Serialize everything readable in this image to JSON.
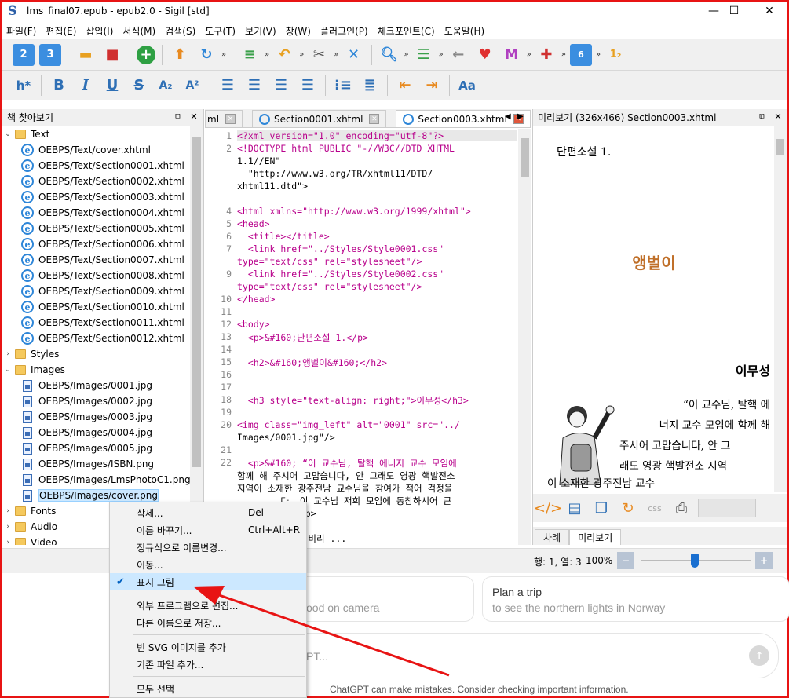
{
  "window": {
    "title": "lms_final07.epub - epub2.0 - Sigil [std]",
    "logo": "S",
    "min": "—",
    "max": "☐",
    "close": "✕"
  },
  "menu": [
    "파일(F)",
    "편집(E)",
    "삽입(I)",
    "서식(M)",
    "검색(S)",
    "도구(T)",
    "보기(V)",
    "창(W)",
    "플러그인(P)",
    "체크포인트(C)",
    "도움말(H)"
  ],
  "toolbar2": {
    "heading": "h*",
    "bold": "B",
    "italic": "I",
    "underline": "U",
    "strike": "S",
    "sub": "A₂",
    "sup": "A²",
    "case": "Aa"
  },
  "book_browser": {
    "title": "책 찾아보기",
    "folders": {
      "text": "Text",
      "styles": "Styles",
      "images": "Images",
      "fonts": "Fonts",
      "audio": "Audio",
      "video": "Video"
    },
    "text_files": [
      "OEBPS/Text/cover.xhtml",
      "OEBPS/Text/Section0001.xhtml",
      "OEBPS/Text/Section0002.xhtml",
      "OEBPS/Text/Section0003.xhtml",
      "OEBPS/Text/Section0004.xhtml",
      "OEBPS/Text/Section0005.xhtml",
      "OEBPS/Text/Section0006.xhtml",
      "OEBPS/Text/Section0007.xhtml",
      "OEBPS/Text/Section0008.xhtml",
      "OEBPS/Text/Section0009.xhtml",
      "OEBPS/Text/Section0010.xhtml",
      "OEBPS/Text/Section0011.xhtml",
      "OEBPS/Text/Section0012.xhtml"
    ],
    "image_files": [
      "OEBPS/Images/0001.jpg",
      "OEBPS/Images/0002.jpg",
      "OEBPS/Images/0003.jpg",
      "OEBPS/Images/0004.jpg",
      "OEBPS/Images/0005.jpg",
      "OEBPS/Images/ISBN.png",
      "OEBPS/Images/LmsPhotoC1.png",
      "OEBPS/Images/cover.png"
    ]
  },
  "editor": {
    "tabs": [
      "ml",
      "Section0001.xhtml",
      "Section0003.xhtml"
    ],
    "lines": [
      {
        "n": "1",
        "t": "<?xml version=\"1.0\" encoding=\"utf-8\"?>"
      },
      {
        "n": "2",
        "t": "<!DOCTYPE html PUBLIC \"-//W3C//DTD XHTML"
      },
      {
        "n": "",
        "t": "1.1//EN\""
      },
      {
        "n": "",
        "t": "  \"http://www.w3.org/TR/xhtml11/DTD/"
      },
      {
        "n": "",
        "t": "xhtml11.dtd\">"
      },
      {
        "n": "",
        "t": ""
      },
      {
        "n": "4",
        "t": "<html xmlns=\"http://www.w3.org/1999/xhtml\">"
      },
      {
        "n": "5",
        "t": "<head>"
      },
      {
        "n": "6",
        "t": "  <title></title>"
      },
      {
        "n": "7",
        "t": "  <link href=\"../Styles/Style0001.css\""
      },
      {
        "n": "",
        "t": "type=\"text/css\" rel=\"stylesheet\"/>"
      },
      {
        "n": "9",
        "t": "  <link href=\"../Styles/Style0002.css\""
      },
      {
        "n": "",
        "t": "type=\"text/css\" rel=\"stylesheet\"/>"
      },
      {
        "n": "10",
        "t": "</head>"
      },
      {
        "n": "11",
        "t": ""
      },
      {
        "n": "12",
        "t": "<body>"
      },
      {
        "n": "13",
        "t": "  <p>&#160;단편소설 1.</p>"
      },
      {
        "n": "14",
        "t": ""
      },
      {
        "n": "15",
        "t": "  <h2>&#160;앵벌이&#160;</h2>"
      },
      {
        "n": "16",
        "t": ""
      },
      {
        "n": "17",
        "t": ""
      },
      {
        "n": "18",
        "t": "  <h3 style=\"text-align: right;\">이무성</h3>"
      },
      {
        "n": "19",
        "t": ""
      },
      {
        "n": "20",
        "t": "<img class=\"img_left\" alt=\"0001\" src=\"../"
      },
      {
        "n": "",
        "t": "Images/0001.jpg\"/>"
      },
      {
        "n": "21",
        "t": ""
      },
      {
        "n": "22",
        "t": "  <p>&#160; “이 교수님, 탈핵 에너지 교수 모임에"
      },
      {
        "n": "",
        "t": "함께 해 주시어 고맙습니다, 안 그래도 영광 핵발전소"
      },
      {
        "n": "",
        "t": "지역이 소재한 광주전남 교수님을 참여가 적어 걱정을"
      },
      {
        "n": "",
        "t": "        다. 이 교수님 저희 모임에 동참하시어 큰"
      },
      {
        "n": "",
        "t": "        요\"</p>"
      },
      {
        "n": "",
        "t": ""
      },
      {
        "n": "",
        "t": "        이 하 비리 ..."
      }
    ]
  },
  "preview": {
    "title": "미리보기 (326x466) Section0003.xhtml",
    "p1": "단편소설 1.",
    "h2": "앵벌이",
    "h3": "이무성",
    "para": [
      "“이 교수님, 탈핵 에",
      "너지 교수 모임에 함께 해",
      "주시어 고맙습니다, 안 그",
      "래도 영광 핵발전소 지역",
      "이 소재한 광주전남 교수"
    ],
    "tabs": [
      "차례",
      "미리보기"
    ]
  },
  "status": {
    "pos": "행: 1, 열: 3",
    "zoom": "100%"
  },
  "context_menu": {
    "items": [
      {
        "label": "삭제...",
        "shortcut": "Del"
      },
      {
        "label": "이름 바꾸기...",
        "shortcut": "Ctrl+Alt+R"
      },
      {
        "label": "정규식으로 이름변경...",
        "shortcut": ""
      },
      {
        "label": "이동...",
        "shortcut": ""
      },
      {
        "label": "표지 그림",
        "shortcut": "",
        "checked": true
      },
      {
        "label": "외부 프로그램으로 편집...",
        "shortcut": ""
      },
      {
        "label": "다른 이름으로 저장...",
        "shortcut": ""
      },
      {
        "label": "빈 SVG 이미지를 추가",
        "shortcut": ""
      },
      {
        "label": "기존 파일 추가...",
        "shortcut": ""
      },
      {
        "label": "모두 선택",
        "shortcut": ""
      }
    ]
  },
  "background_page": {
    "card1_sub": "ood on camera",
    "card2_title": "Plan a trip",
    "card2_sub": "to see the northern lights in Norway",
    "input_placeholder": "PT...",
    "disclaimer": "ChatGPT can make mistakes. Consider checking important information."
  },
  "colors": {
    "annotation_red": "#e81414",
    "heading_orange": "#c0702a",
    "selection": "#cce8ff"
  }
}
